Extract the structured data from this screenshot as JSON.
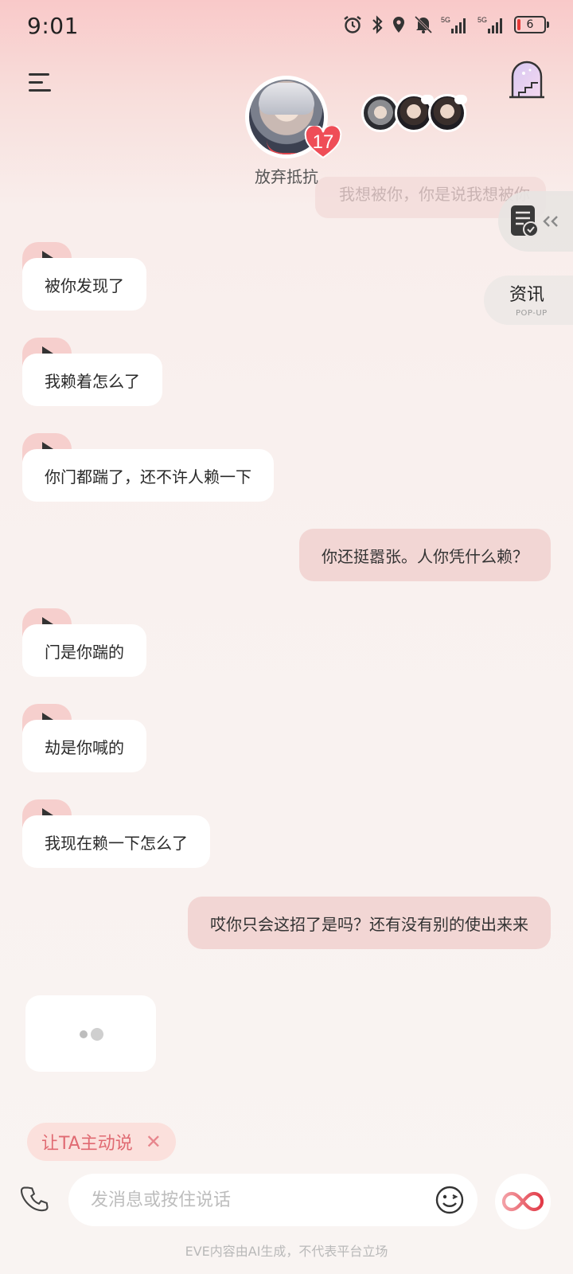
{
  "status_bar": {
    "time": "9:01",
    "battery": "6",
    "icons": [
      "alarm-icon",
      "bluetooth-icon",
      "location-icon",
      "mute-icon",
      "signal-5g-icon",
      "signal-5g-icon"
    ]
  },
  "header": {
    "character_name": "放弃抵抗",
    "affinity_level": "17",
    "menu_icon": "menu-icon",
    "portal_icon": "portal-door-icon"
  },
  "faded_message": "我想被你，你是说我想被你",
  "side_buttons": {
    "news_label": "资讯",
    "news_sub": "POP-UP",
    "doc_icon": "document-check-icon"
  },
  "messages": [
    {
      "from": "ai",
      "text": "被你发现了"
    },
    {
      "from": "ai",
      "text": "我赖着怎么了"
    },
    {
      "from": "ai",
      "text": "你门都踹了，还不许人赖一下"
    },
    {
      "from": "user",
      "text": "你还挺嚣张。人你凭什么赖？"
    },
    {
      "from": "ai",
      "text": "门是你踹的"
    },
    {
      "from": "ai",
      "text": "劫是你喊的"
    },
    {
      "from": "ai",
      "text": "我现在赖一下怎么了"
    },
    {
      "from": "user",
      "text": "哎你只会这招了是吗？还有没有别的使出来来"
    }
  ],
  "suggestion_chip": "让TA主动说",
  "input": {
    "placeholder": "发消息或按住说话"
  },
  "footer_note": "EVE内容由AI生成，不代表平台立场",
  "colors": {
    "user_bubble": "#f2d6d4",
    "ai_bubble": "#ffffff",
    "accent": "#e4474f",
    "chip_text": "#e06a72"
  }
}
